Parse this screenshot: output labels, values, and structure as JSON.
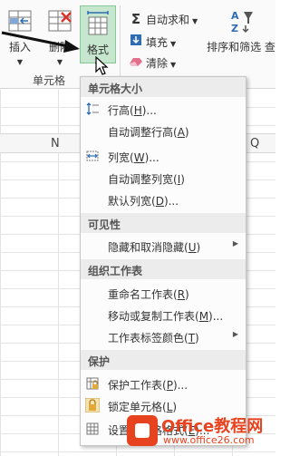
{
  "ribbon": {
    "insert_label": "插入",
    "delete_label": "删除",
    "format_label": "格式",
    "group_label": "单元格",
    "autosum_label": "自动求和",
    "fill_label": "填充",
    "clear_label": "清除",
    "sort_label": "排序和筛选",
    "sort_trailing": "查"
  },
  "sheet": {
    "col_n": "N",
    "col_q": "Q"
  },
  "menu": {
    "sections": {
      "cell_size": "单元格大小",
      "visibility": "可见性",
      "organize": "组织工作表",
      "protection": "保护"
    },
    "items": {
      "row_height": {
        "text": "行高(",
        "key": "H",
        "suffix": ")..."
      },
      "autofit_row": {
        "text": "自动调整行高(",
        "key": "A",
        "suffix": ")"
      },
      "col_width": {
        "text": "列宽(",
        "key": "W",
        "suffix": ")..."
      },
      "autofit_col": {
        "text": "自动调整列宽(",
        "key": "I",
        "suffix": ")"
      },
      "default_width": {
        "text": "默认列宽(",
        "key": "D",
        "suffix": ")..."
      },
      "hide_unhide": {
        "text": "隐藏和取消隐藏(",
        "key": "U",
        "suffix": ")"
      },
      "rename_sheet": {
        "text": "重命名工作表(",
        "key": "R",
        "suffix": ")"
      },
      "move_copy": {
        "text": "移动或复制工作表(",
        "key": "M",
        "suffix": ")..."
      },
      "tab_color": {
        "text": "工作表标签颜色(",
        "key": "T",
        "suffix": ")"
      },
      "protect_sheet": {
        "text": "保护工作表(",
        "key": "P",
        "suffix": ")..."
      },
      "lock_cell": {
        "text": "锁定单元格(",
        "key": "L",
        "suffix": ")"
      },
      "format_cells": {
        "text": "设置单元格格式(",
        "key": "E",
        "suffix": ")..."
      }
    }
  },
  "watermark": {
    "title": "Office教程网",
    "url": "www.office26.com"
  },
  "colors": {
    "format_highlight": "#c6e7ce",
    "watermark": "#e8431f"
  }
}
